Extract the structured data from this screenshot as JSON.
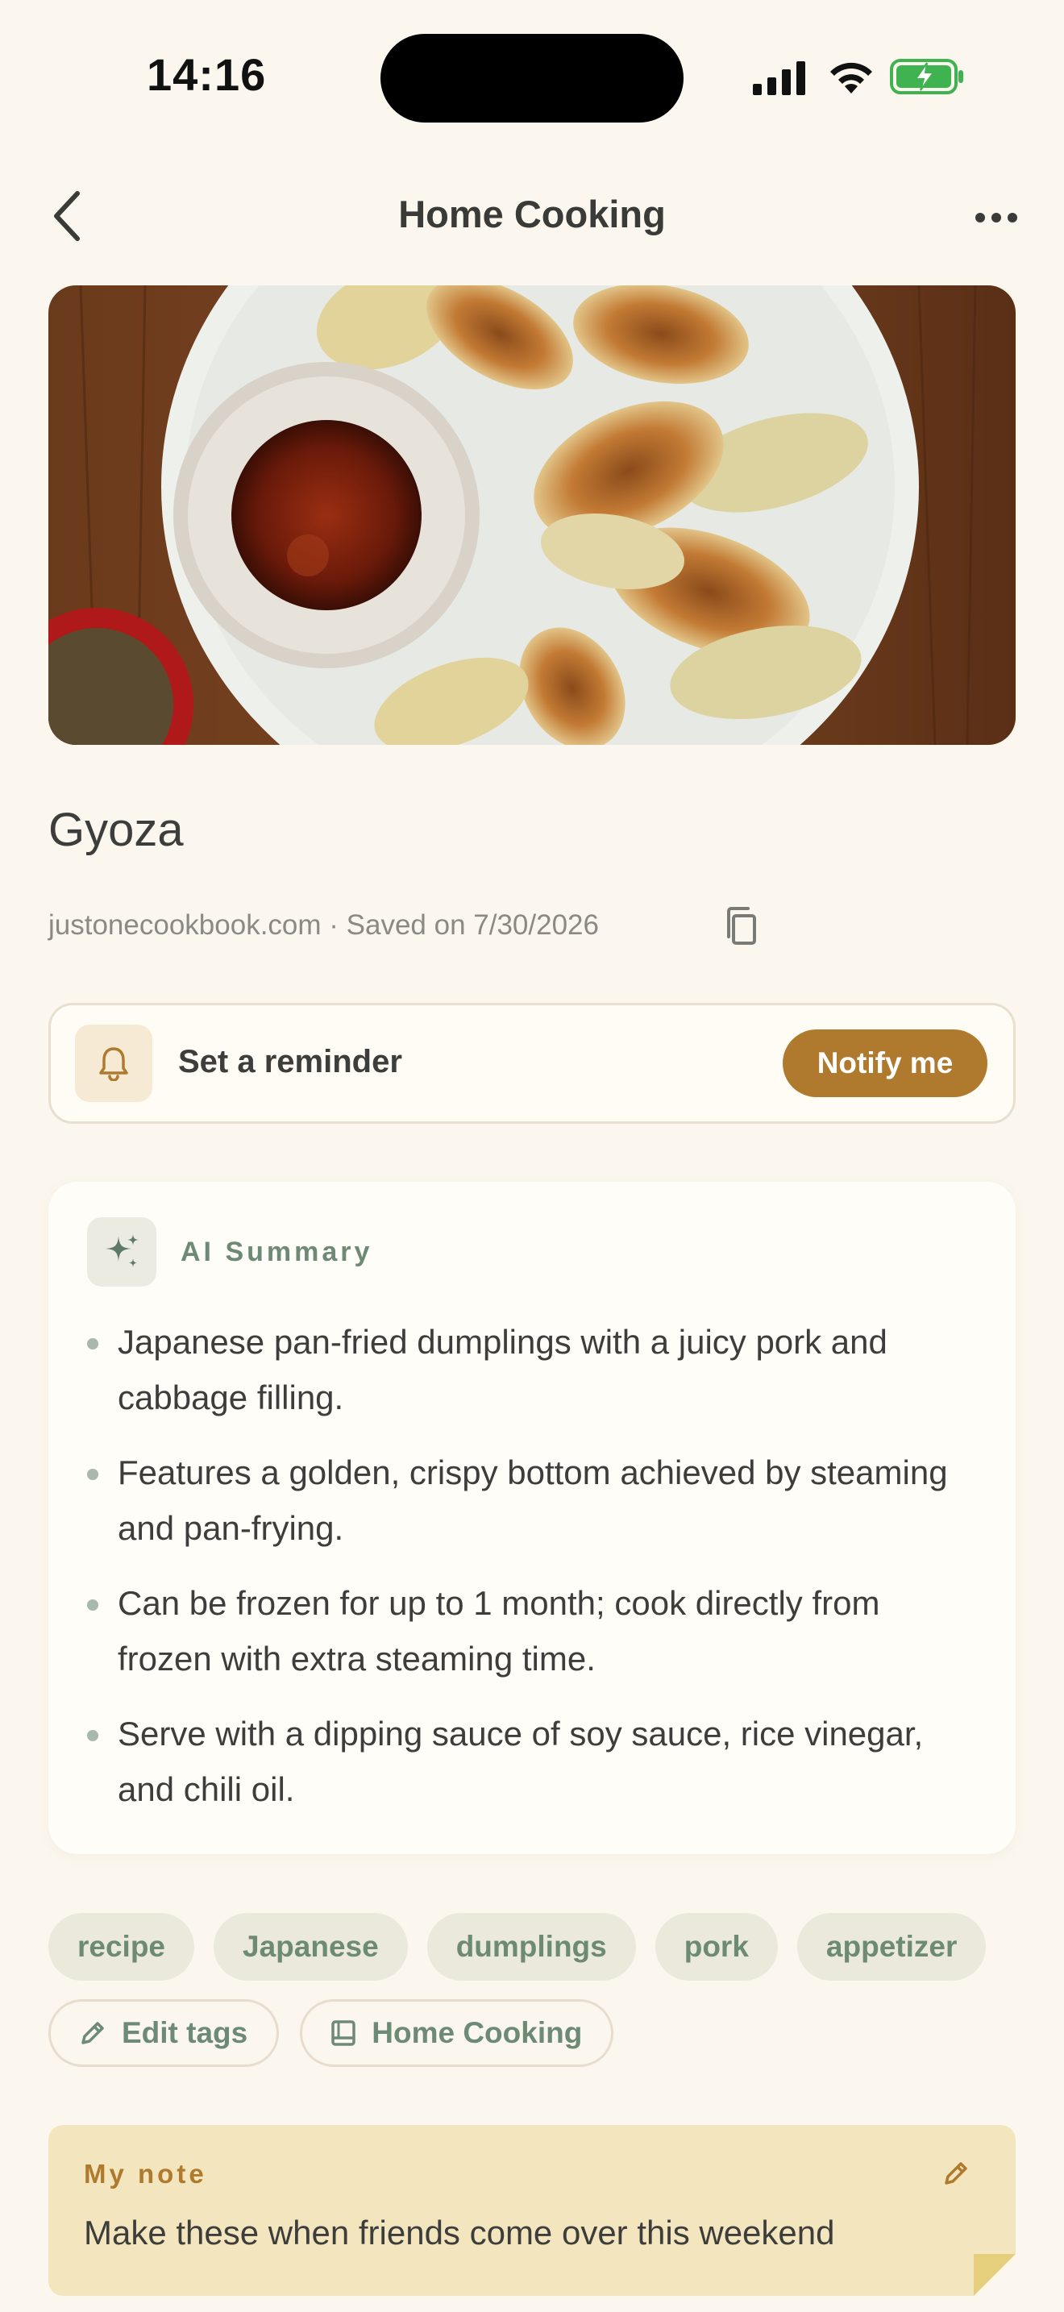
{
  "status_bar": {
    "time": "14:16",
    "icons": [
      "cellular-signal-icon",
      "wifi-icon",
      "battery-charging-icon"
    ]
  },
  "nav": {
    "title": "Home Cooking",
    "back_icon": "chevron-left-icon",
    "more_icon": "ellipsis-icon"
  },
  "recipe": {
    "title": "Gyoza",
    "source": "justonecookbook.com",
    "separator": " · ",
    "saved": "Saved on 7/30/2026"
  },
  "reminder": {
    "label": "Set a reminder",
    "button": "Notify me",
    "icon": "bell-icon"
  },
  "ai_summary": {
    "label": "AI Summary",
    "icon": "sparkle-icon",
    "bullets": [
      "Japanese pan-fried dumplings with a juicy pork and cabbage filling.",
      "Features a golden, crispy bottom achieved by steaming and pan-frying.",
      "Can be frozen for up to 1 month; cook directly from frozen with extra steaming time.",
      "Serve with a dipping sauce of soy sauce, rice vinegar, and chili oil."
    ]
  },
  "tags": [
    "recipe",
    "Japanese",
    "dumplings",
    "pork",
    "appetizer"
  ],
  "actions": {
    "edit_tags": "Edit tags",
    "collection": "Home Cooking"
  },
  "note": {
    "label": "My note",
    "text": "Make these when friends come over this weekend"
  },
  "colors": {
    "background": "#fcf7ee",
    "accent": "#b07a2e",
    "sage": "#6c8a74",
    "note_bg": "#f3e6be"
  }
}
